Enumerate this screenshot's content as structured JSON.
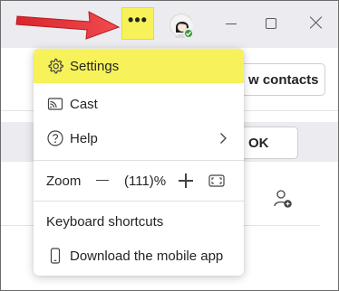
{
  "titlebar": {
    "more_label": "•••",
    "avatar_icon": "avatar-icon",
    "presence_color": "#3b9b3a",
    "highlight_color": "#f7f25a"
  },
  "background": {
    "contacts_button": "w contacts",
    "ok_button": "OK"
  },
  "menu": {
    "settings": "Settings",
    "cast": "Cast",
    "help": "Help",
    "zoom_label": "Zoom",
    "zoom_value": "(111)%",
    "keyboard_shortcuts": "Keyboard shortcuts",
    "download_app": "Download the mobile app"
  },
  "annotation": {
    "arrow_color": "#e8393d"
  }
}
